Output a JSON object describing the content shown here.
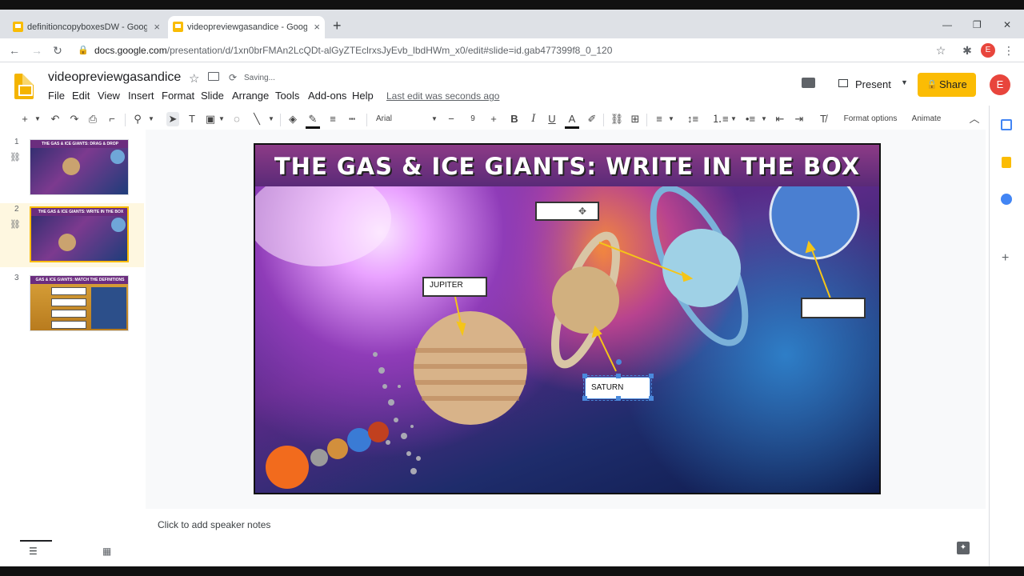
{
  "browser": {
    "tabs": [
      {
        "label": "definitioncopyboxesDW - Googl…",
        "close": "×"
      },
      {
        "label": "videopreviewgasandice - Googl…",
        "close": "×"
      }
    ],
    "new_tab": "+",
    "window": {
      "minimize": "—",
      "restore": "❐",
      "close": "✕"
    },
    "url_host": "docs.google.com",
    "url_path": "/presentation/d/1xn0brFMAn2LcQDt-alGyZTEclrxsJyEvb_lbdHWm_x0/edit#slide=id.gab477399f8_0_120",
    "profile_initial": "E"
  },
  "app": {
    "title": "videopreviewgasandice",
    "status": "Saving...",
    "menu": [
      "File",
      "Edit",
      "View",
      "Insert",
      "Format",
      "Slide",
      "Arrange",
      "Tools",
      "Add-ons",
      "Help"
    ],
    "last_edit": "Last edit was seconds ago",
    "present_label": "Present",
    "share_label": "Share",
    "avatar_initial": "E"
  },
  "toolbar": {
    "font": "Arial",
    "font_size": "9",
    "format_options": "Format options",
    "animate": "Animate"
  },
  "filmstrip": {
    "slides": [
      {
        "num": "1",
        "title": "THE GAS & ICE GIANTS: DRAG & DROP"
      },
      {
        "num": "2",
        "title": "THE GAS & ICE GIANTS: WRITE IN THE BOX"
      },
      {
        "num": "3",
        "title": "GAS & ICE GIANTS: MATCH THE DEFINITIONS"
      }
    ]
  },
  "slide": {
    "title": "THE GAS & ICE GIANTS: WRITE IN THE BOX",
    "labels": {
      "jupiter": "JUPITER",
      "saturn": "SATURN",
      "uranus": "",
      "neptune": ""
    }
  },
  "notes": {
    "placeholder": "Click to add speaker notes"
  },
  "colors": {
    "accent": "#f9bc04",
    "share": "#fbbc04",
    "avatar": "#e8453c",
    "title_band": "#7a3583"
  }
}
